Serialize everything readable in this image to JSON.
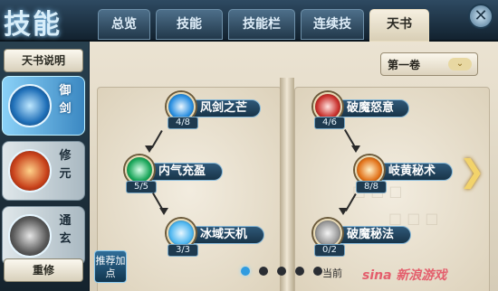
{
  "header": {
    "logo_text": "技能",
    "tabs": [
      {
        "label": "总览",
        "active": false
      },
      {
        "label": "技能",
        "active": false
      },
      {
        "label": "技能栏",
        "active": false
      },
      {
        "label": "连续技",
        "active": false
      },
      {
        "label": "天书",
        "active": true
      }
    ],
    "close_icon": "close-x-icon"
  },
  "sidebar": {
    "help_button": "天书说明",
    "categories": [
      {
        "label": "御剑",
        "icon": "sword-rune-orb-icon",
        "color": "#1f6fb8",
        "active": true
      },
      {
        "label": "修元",
        "icon": "fire-rune-orb-icon",
        "color": "#c8421b",
        "active": false
      },
      {
        "label": "通玄",
        "icon": "grey-rune-orb-icon",
        "color": "#5a5a5a",
        "active": false
      }
    ],
    "reset_button": "重修"
  },
  "book": {
    "volume_select": "第一卷",
    "left_skills": [
      {
        "name": "风剑之芒",
        "count": "4/8",
        "icon": "wind-sword-icon",
        "color": "#2a8fe0"
      },
      {
        "name": "内气充盈",
        "count": "5/5",
        "icon": "inner-qi-icon",
        "color": "#1aa65a"
      },
      {
        "name": "冰域天机",
        "count": "3/3",
        "icon": "ice-domain-icon",
        "color": "#4fb7f0"
      }
    ],
    "right_skills": [
      {
        "name": "破魔怒意",
        "count": "4/6",
        "icon": "break-demon-rage-icon",
        "color": "#c9302c"
      },
      {
        "name": "岐黄秘术",
        "count": "8/8",
        "icon": "qihuang-art-icon",
        "color": "#e2731a"
      },
      {
        "name": "破魔秘法",
        "count": "0/2",
        "icon": "break-demon-method-icon",
        "color": "#9a9a9a"
      }
    ],
    "tip_label": "推荐加点",
    "next_arrow": "chevron-right-icon",
    "page_dots": 5,
    "current_page": 1,
    "current_page_label": "当前",
    "watermark": "sina 新浪游戏"
  }
}
